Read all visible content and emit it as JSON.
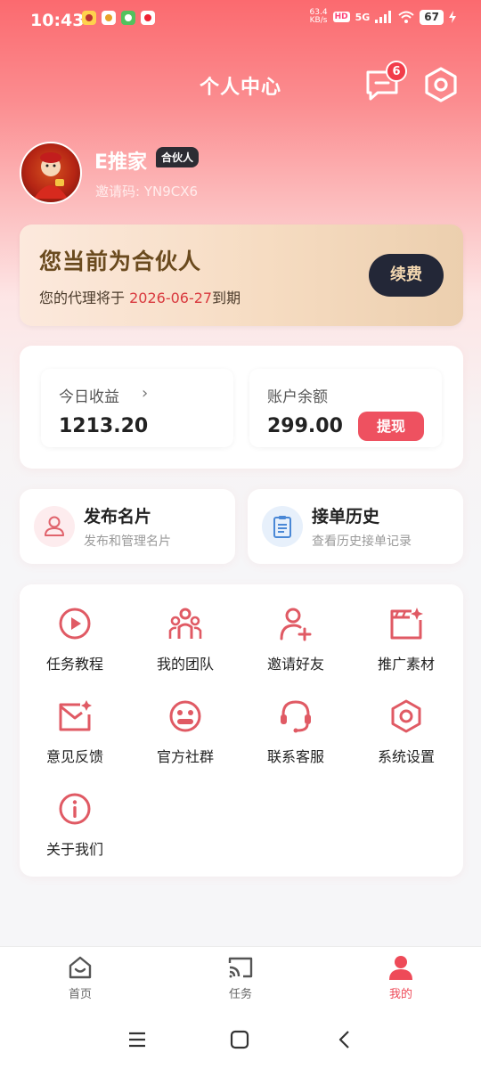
{
  "status_bar": {
    "time": "10:43",
    "net_speed": "63.4",
    "net_unit": "KB/s",
    "hd": "HD",
    "signal": "5G",
    "battery": "67"
  },
  "header": {
    "title": "个人中心",
    "message_badge": "6"
  },
  "profile": {
    "name": "E推家",
    "role_tag": "合伙人",
    "invite_code": "邀请码: YN9CX6"
  },
  "partner_card": {
    "title": "您当前为合伙人",
    "desc_prefix": "您的代理将于 ",
    "expire_date": "2026-06-27",
    "desc_suffix": "到期",
    "renew_label": "续费"
  },
  "earnings": {
    "today_label": "今日收益",
    "today_value": "1213.20",
    "balance_label": "账户余额",
    "balance_value": "299.00",
    "withdraw_label": "提现"
  },
  "quick_actions": [
    {
      "title": "发布名片",
      "subtitle": "发布和管理名片",
      "icon": "user-card-icon"
    },
    {
      "title": "接单历史",
      "subtitle": "查看历史接单记录",
      "icon": "clipboard-icon"
    }
  ],
  "menu": [
    {
      "label": "任务教程",
      "icon": "play-circle-icon"
    },
    {
      "label": "我的团队",
      "icon": "team-icon"
    },
    {
      "label": "邀请好友",
      "icon": "add-user-icon"
    },
    {
      "label": "推广素材",
      "icon": "material-icon"
    },
    {
      "label": "意见反馈",
      "icon": "feedback-mail-icon"
    },
    {
      "label": "官方社群",
      "icon": "community-icon"
    },
    {
      "label": "联系客服",
      "icon": "headset-icon"
    },
    {
      "label": "系统设置",
      "icon": "settings-hex-icon"
    },
    {
      "label": "关于我们",
      "icon": "info-icon"
    }
  ],
  "bottom_nav": [
    {
      "label": "首页",
      "icon": "home-icon",
      "active": false
    },
    {
      "label": "任务",
      "icon": "task-cast-icon",
      "active": false
    },
    {
      "label": "我的",
      "icon": "user-icon",
      "active": true
    }
  ],
  "colors": {
    "accent": "#ee4a58",
    "gradient_top": "#fb6a6f",
    "renew_button": "#232737",
    "date_red": "#d9393e"
  }
}
